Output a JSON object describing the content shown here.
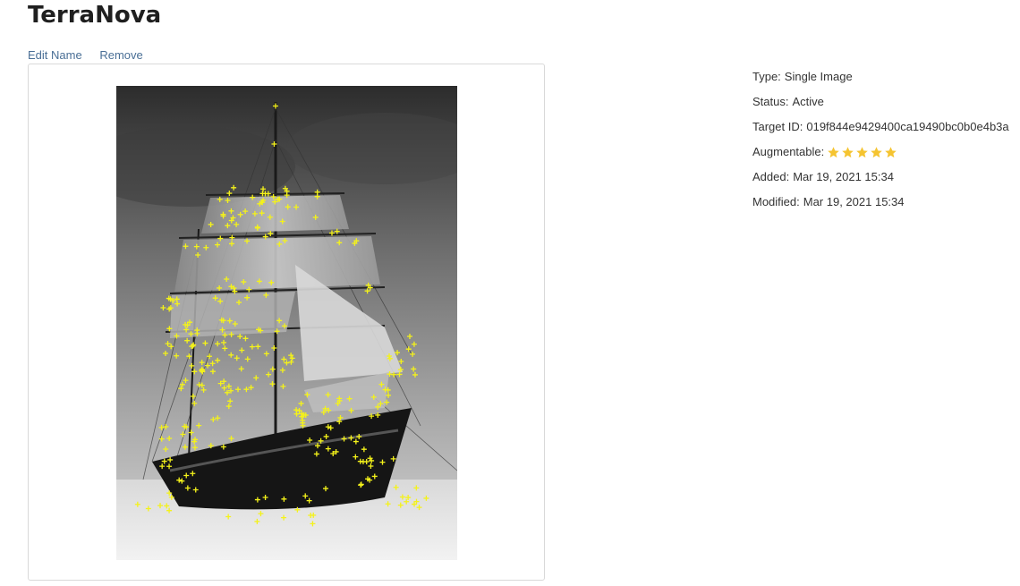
{
  "page": {
    "title": "TerraNova"
  },
  "actions": {
    "edit_name": "Edit Name",
    "remove": "Remove"
  },
  "details": {
    "type_label": "Type:",
    "type_value": "Single Image",
    "status_label": "Status:",
    "status_value": "Active",
    "target_id_label": "Target ID:",
    "target_id_value": "019f844e9429400ca19490bc0b0e4b3a",
    "augmentable_label": "Augmentable:",
    "augmentable_rating": 5,
    "augmentable_max": 5,
    "added_label": "Added:",
    "added_value": "Mar 19, 2021 15:34",
    "modified_label": "Modified:",
    "modified_value": "Mar 19, 2021 15:34"
  },
  "colors": {
    "star": "#f5c431",
    "feature_marker": "#f4f21a",
    "link": "#4a6f96"
  },
  "icons": {
    "rating": "star-icon",
    "feature": "plus-marker-icon"
  }
}
